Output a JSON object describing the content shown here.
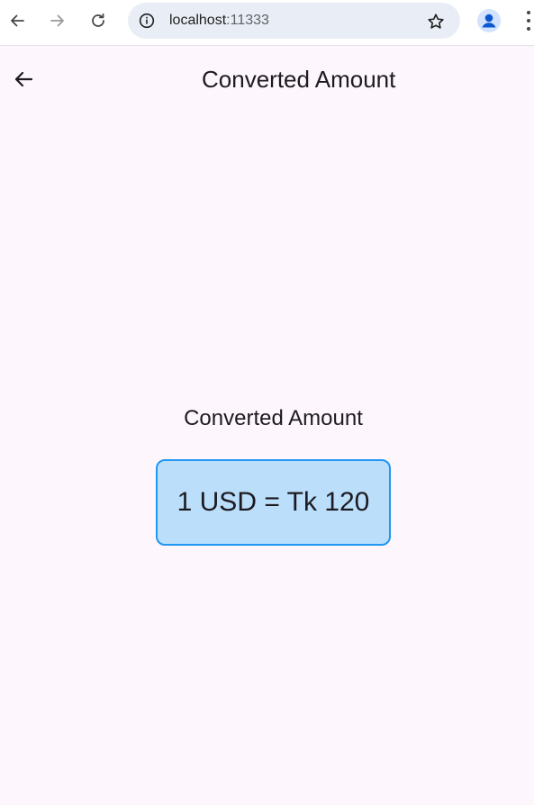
{
  "browser": {
    "url_host": "localhost",
    "url_port": ":11333"
  },
  "app_bar": {
    "title": "Converted Amount"
  },
  "content": {
    "heading": "Converted Amount",
    "result": "1 USD = Tk 120"
  },
  "colors": {
    "page_background": "#fdf7fd",
    "result_background": "#bbdefb",
    "result_border": "#2196f3",
    "text": "#1d1b20"
  },
  "icons": {
    "back": "arrow-left-icon",
    "forward": "arrow-right-icon",
    "reload": "reload-icon",
    "site_info": "info-icon",
    "bookmark": "star-icon",
    "profile": "person-icon",
    "menu": "more-vertical-icon"
  }
}
